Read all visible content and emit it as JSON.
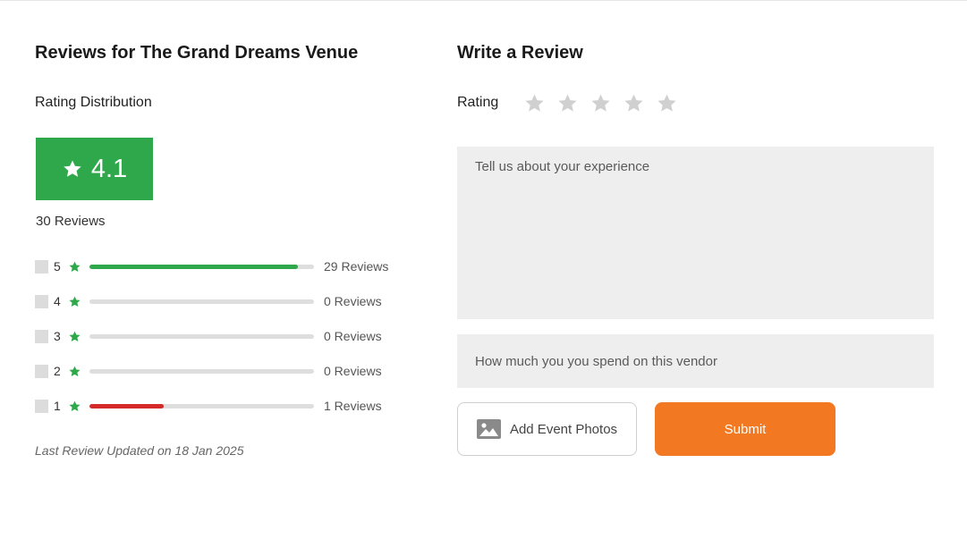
{
  "reviews": {
    "title": "Reviews for The Grand Dreams Venue",
    "distribution_label": "Rating Distribution",
    "average_score": "4.1",
    "score_color": "#2ea84b",
    "total_reviews": "30 Reviews",
    "rows": [
      {
        "level": "5",
        "count_label": "29 Reviews",
        "fill_fraction": 0.93,
        "bar_color": "#2ea84b"
      },
      {
        "level": "4",
        "count_label": "0 Reviews",
        "fill_fraction": 0,
        "bar_color": "#2ea84b"
      },
      {
        "level": "3",
        "count_label": "0 Reviews",
        "fill_fraction": 0,
        "bar_color": "#2ea84b"
      },
      {
        "level": "2",
        "count_label": "0 Reviews",
        "fill_fraction": 0,
        "bar_color": "#2ea84b"
      },
      {
        "level": "1",
        "count_label": "1 Reviews",
        "fill_fraction": 0.33,
        "bar_color": "#d42a2a"
      }
    ],
    "last_updated": "Last Review Updated on 18 Jan 2025"
  },
  "write_review": {
    "title": "Write a Review",
    "rating_label": "Rating",
    "rating_value": 0,
    "experience_placeholder": "Tell us about your experience",
    "spend_placeholder": "How much you you spend on this vendor",
    "add_photos_label": "Add Event Photos",
    "submit_label": "Submit",
    "submit_color": "#f27922"
  },
  "icons": {
    "score_star": "star-icon",
    "row_star": "star-icon",
    "rating_star": "star-outline-icon",
    "photo": "image-icon"
  }
}
